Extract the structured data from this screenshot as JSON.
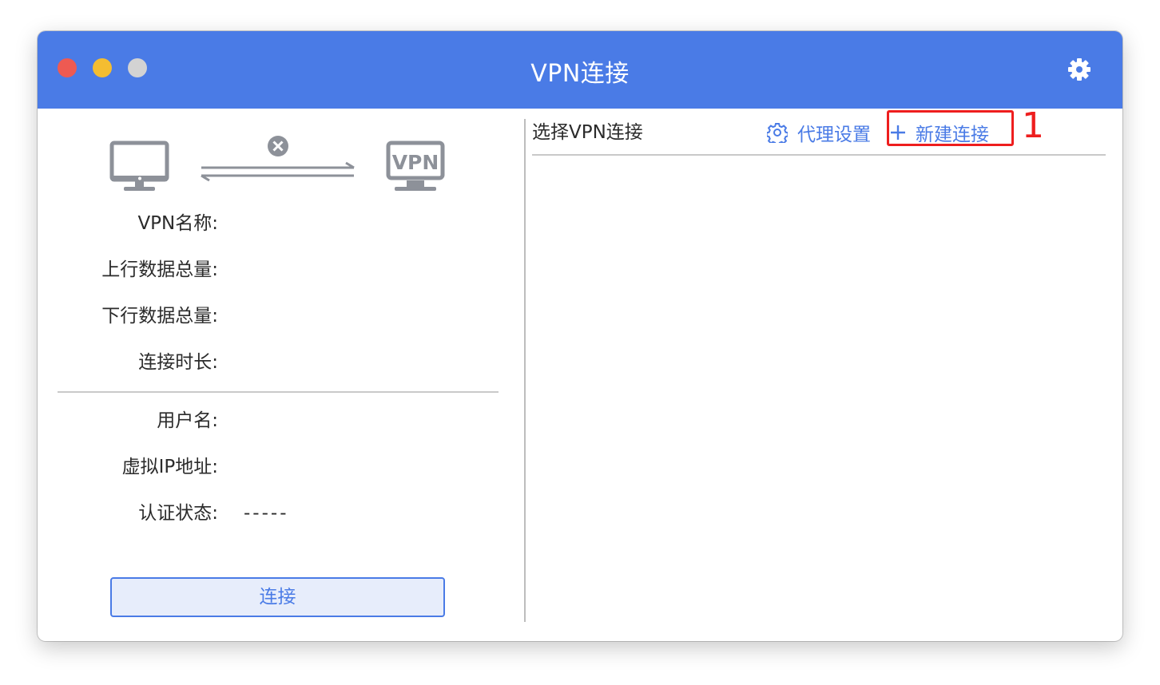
{
  "window": {
    "title": "VPN连接",
    "accent_color": "#4a7be6",
    "traffic_lights": [
      "close",
      "minimize",
      "zoom"
    ]
  },
  "status_graphic": {
    "left_icon": "monitor-icon",
    "link_icon": "disconnected-icon",
    "right_icon": "vpn-server-icon",
    "vpn_badge_text": "VPN"
  },
  "info": {
    "vpn_name_label": "VPN名称:",
    "upload_total_label": "上行数据总量:",
    "download_total_label": "下行数据总量:",
    "duration_label": "连接时长:",
    "username_label": "用户名:",
    "virtual_ip_label": "虚拟IP地址:",
    "auth_status_label": "认证状态:",
    "auth_status_value": "-----"
  },
  "connect_button_label": "连接",
  "right_panel": {
    "title": "选择VPN连接",
    "proxy_settings_label": "代理设置",
    "new_connection_label": "新建连接",
    "annotation_number": "1",
    "annotation_color": "#ee1e1e",
    "connections": []
  }
}
